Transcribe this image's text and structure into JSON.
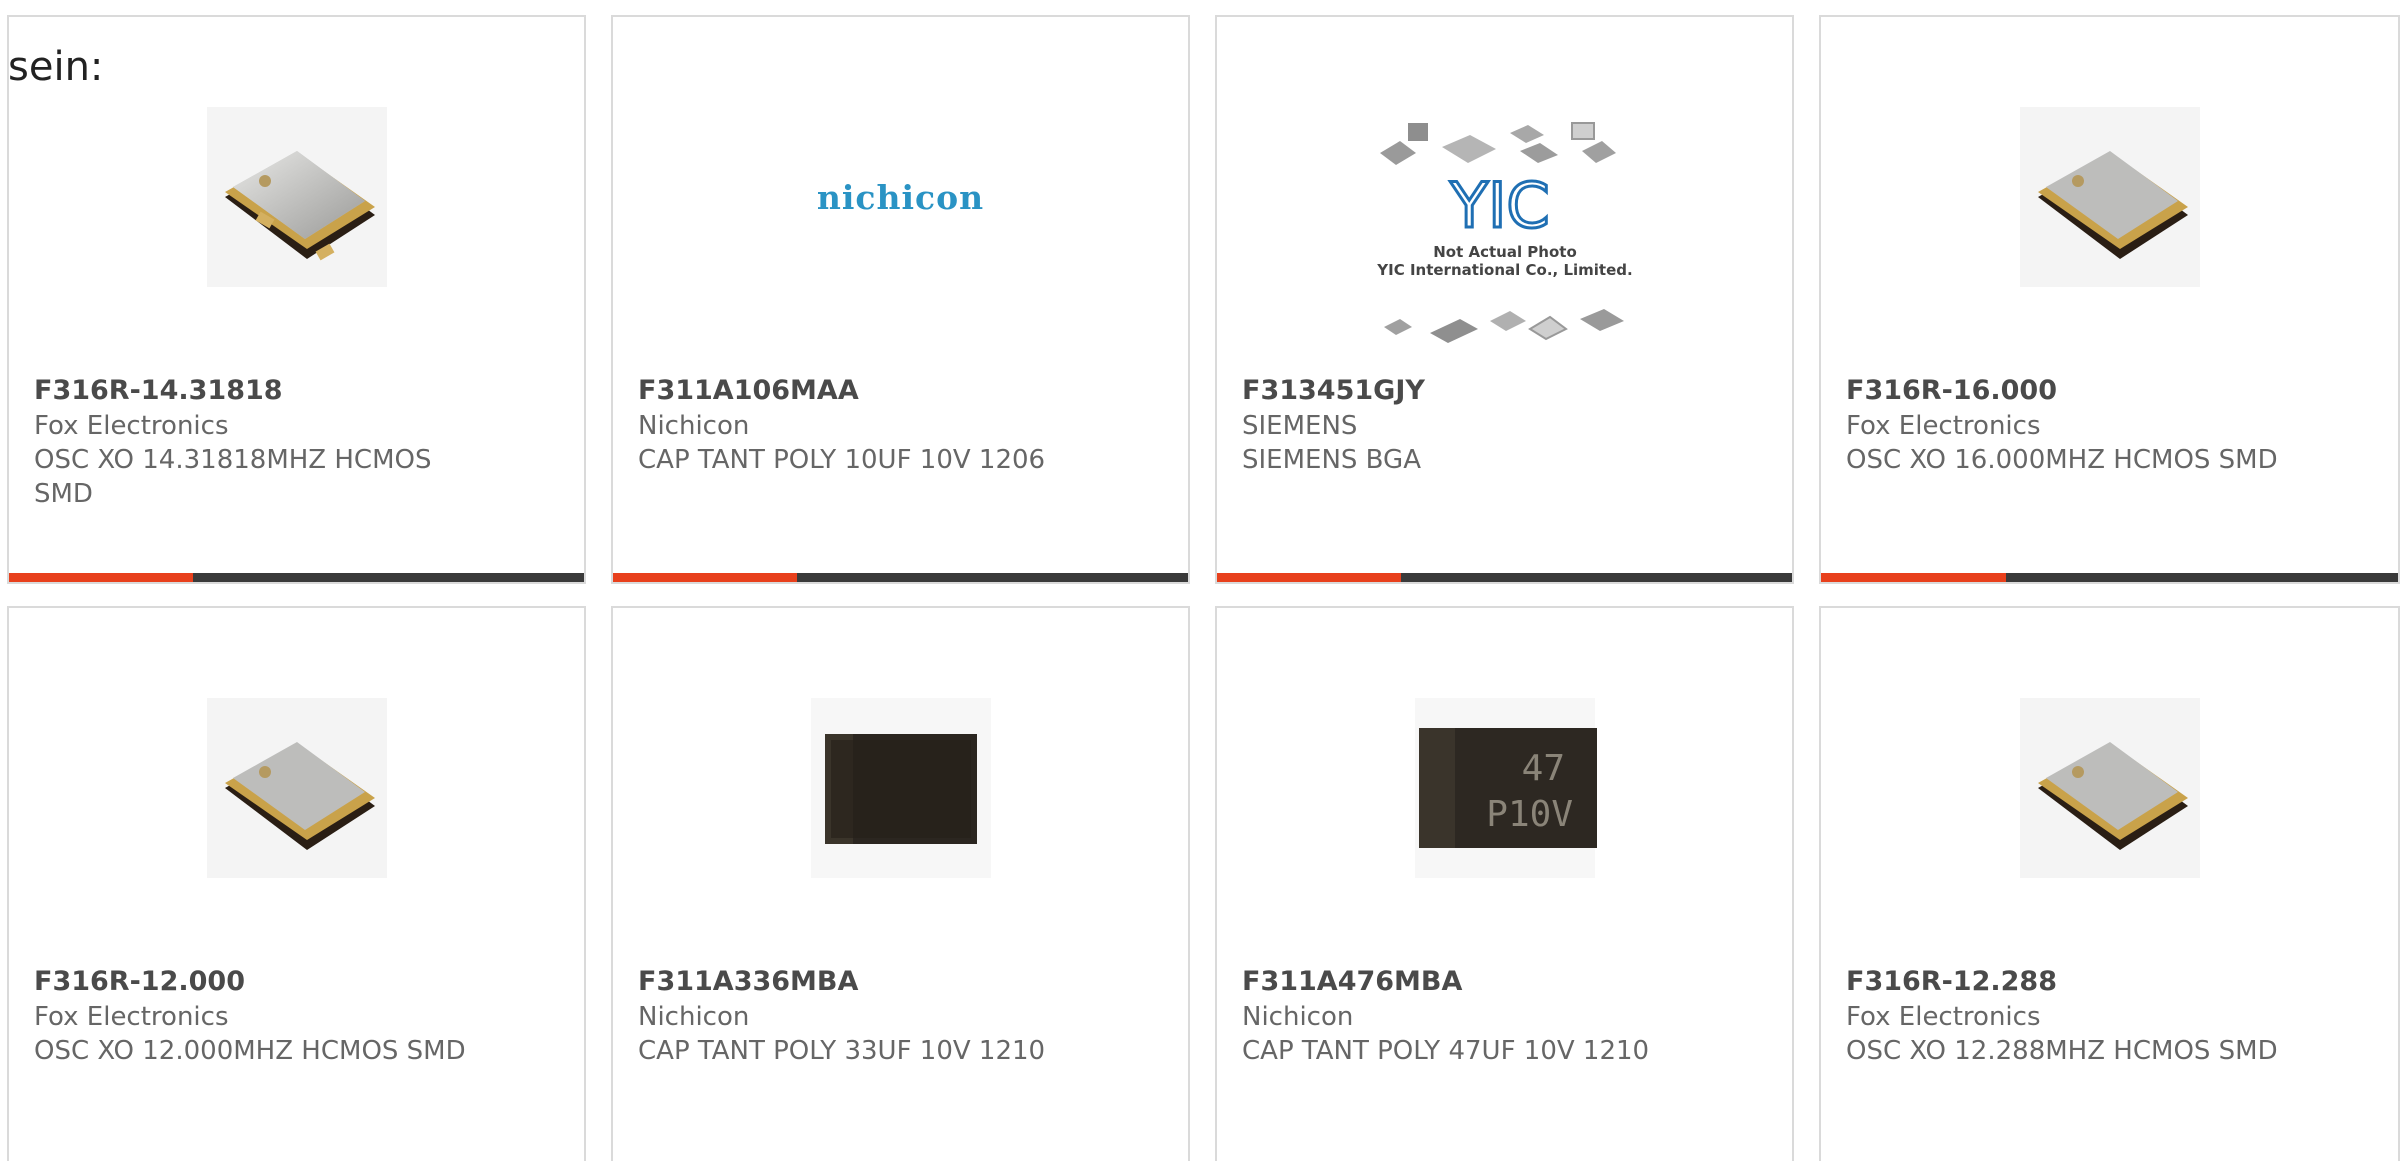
{
  "lead_text": "sein:",
  "accent_color": "#e8401c",
  "products": [
    {
      "part_number": "F316R-14.31818",
      "manufacturer": "Fox Electronics",
      "description": "OSC XO 14.31818MHZ HCMOS SMD",
      "image": "oscillator-icon",
      "progress": 0.32
    },
    {
      "part_number": "F311A106MAA",
      "manufacturer": "Nichicon",
      "description": "CAP TANT POLY 10UF 10V 1206",
      "image": "nichicon-logo",
      "logo_text": "nichicon",
      "progress": 0.32
    },
    {
      "part_number": "F313451GJY",
      "manufacturer": "SIEMENS",
      "description": "SIEMENS BGA",
      "image": "yic-placeholder",
      "placeholder_lines": [
        "Not Actual Photo",
        "YIC International Co., Limited."
      ],
      "progress": 0.32
    },
    {
      "part_number": "F316R-16.000",
      "manufacturer": "Fox Electronics",
      "description": "OSC XO 16.000MHZ HCMOS SMD",
      "image": "oscillator-icon",
      "progress": 0.32
    },
    {
      "part_number": "F316R-12.000",
      "manufacturer": "Fox Electronics",
      "description": "OSC XO 12.000MHZ HCMOS SMD",
      "image": "oscillator-icon"
    },
    {
      "part_number": "F311A336MBA",
      "manufacturer": "Nichicon",
      "description": "CAP TANT POLY 33UF 10V 1210",
      "image": "tantalum-capacitor-icon"
    },
    {
      "part_number": "F311A476MBA",
      "manufacturer": "Nichicon",
      "description": "CAP TANT POLY 47UF 10V 1210",
      "image": "tantalum-capacitor-icon",
      "marking_lines": [
        "47",
        "P10V"
      ]
    },
    {
      "part_number": "F316R-12.288",
      "manufacturer": "Fox Electronics",
      "description": "OSC XO 12.288MHZ HCMOS SMD",
      "image": "oscillator-icon"
    }
  ]
}
